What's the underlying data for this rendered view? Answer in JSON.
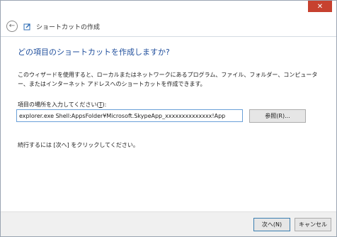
{
  "window": {
    "title": "ショートカットの作成",
    "close_glyph": "✕"
  },
  "nav": {
    "back_glyph": "←"
  },
  "heading": "どの項目のショートカットを作成しますか?",
  "description": "このウィザードを使用すると、ローカルまたはネットワークにあるプログラム、ファイル、フォルダー、コンピューター、またはインターネット アドレスへのショートカットを作成できます。",
  "location": {
    "label_pre": "項目の場所を入力してください(",
    "label_key": "T",
    "label_post": "):",
    "value": "explorer.exe Shell:AppsFolder¥Microsoft.SkypeApp_xxxxxxxxxxxxxx!App"
  },
  "browse_label": "参照(R)...",
  "continue_text": "続行するには [次へ] をクリックしてください。",
  "footer": {
    "next_label": "次へ(N)",
    "cancel_label": "キャンセル"
  }
}
